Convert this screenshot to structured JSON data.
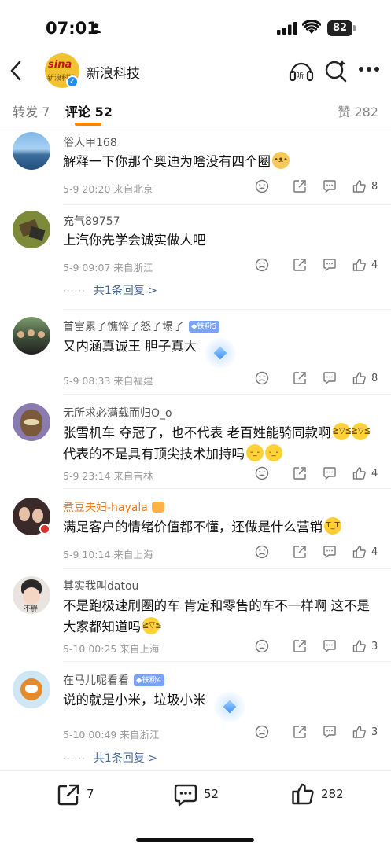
{
  "status_bar": {
    "time": "07:01",
    "battery": "82"
  },
  "nav": {
    "title": "新浪科技",
    "logo_text": "sina",
    "logo_subtext": "新浪科技"
  },
  "tabs": {
    "repost": "转发 7",
    "comments": "评论 52",
    "likes": "赞 282"
  },
  "comments": [
    {
      "name": "俗人甲168",
      "text": "解释一下你那个奥迪为啥没有四个圈",
      "meta": "5-9 20:20 来自北京",
      "likes": "8"
    },
    {
      "name": "充气89757",
      "text": "上汽你先学会诚实做人吧",
      "meta": "5-9 09:07 来自浙江",
      "likes": "4",
      "replies": "共1条回复 >"
    },
    {
      "name": "首富累了憔悴了怒了塌了",
      "badge": "铁粉5",
      "text": "又内涵真诚王 胆子真大",
      "meta": "5-9 08:33 来自福建",
      "likes": "8"
    },
    {
      "name": "无所求必满载而归O_o",
      "text_line1": "张雪机车  夺冠了，也不代表 老百姓能骑同款啊",
      "text_line2": "代表的不是具有顶尖技术加持吗",
      "meta": "5-9 23:14 来自吉林",
      "likes": "4"
    },
    {
      "name": "煮豆夫妇-hayala",
      "text": "满足客户的情绪价值都不懂，还做是什么营销",
      "meta": "5-9 10:14 来自上海",
      "likes": "4"
    },
    {
      "name": "其实我叫datou",
      "text_line1": "不是跑极速刷圈的车 肯定和零售的车不一样啊  这不是",
      "text_line2": "大家都知道吗",
      "meta": "5-10 00:25 来自上海",
      "likes": "3",
      "avatar_text": "不胖"
    },
    {
      "name": "在马儿呢看看",
      "badge": "铁粉4",
      "text": "说的就是小米，垃圾小米",
      "meta": "5-10 00:49 来自浙江",
      "likes": "3",
      "replies": "共1条回复 >"
    }
  ],
  "bottom_bar": {
    "reposts": "7",
    "comments": "52",
    "likes": "282"
  },
  "icons": [
    "back-icon",
    "listen-icon",
    "search-ai-icon",
    "more-icon",
    "dislike-icon",
    "share-icon",
    "reply-icon",
    "like-icon"
  ],
  "colors": {
    "accent": "#ff8200",
    "link": "#496796",
    "fan_badge": "#7aa3f5",
    "verified": "#1e8ff0"
  }
}
